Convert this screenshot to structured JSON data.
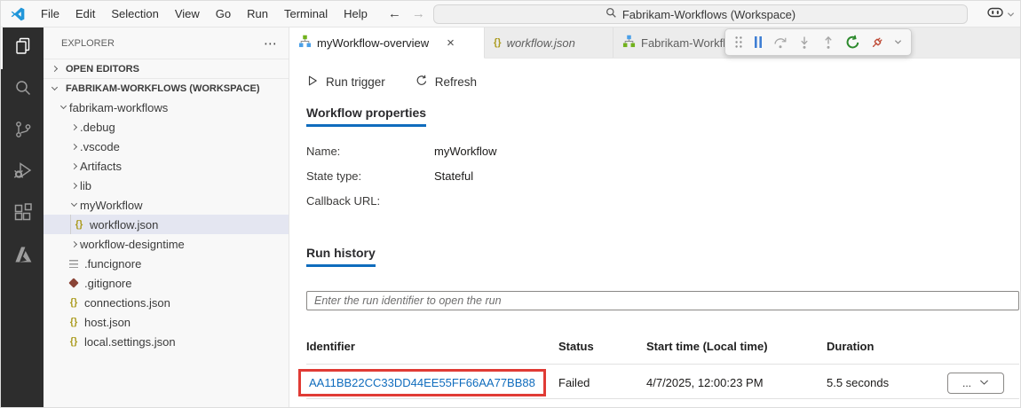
{
  "titlebar": {
    "menus": [
      "File",
      "Edit",
      "Selection",
      "View",
      "Go",
      "Run",
      "Terminal",
      "Help"
    ],
    "back_arrow": "←",
    "forward_arrow": "→",
    "search_label": "Fabrikam-Workflows (Workspace)"
  },
  "activity_bar": {
    "items": [
      "explorer",
      "search",
      "source-control",
      "run-and-debug",
      "extensions",
      "azure"
    ],
    "active_item": "explorer"
  },
  "sidebar": {
    "title": "EXPLORER",
    "sections": [
      {
        "label": "OPEN EDITORS",
        "expanded": false
      },
      {
        "label": "FABRIKAM-WORKFLOWS (WORKSPACE)",
        "expanded": true
      }
    ],
    "tree": [
      {
        "label": "fabrikam-workflows",
        "icon": "chevron-down-icon"
      },
      {
        "label": ".debug",
        "icon": "chevron-right-icon"
      },
      {
        "label": ".vscode",
        "icon": "chevron-right-icon"
      },
      {
        "label": "Artifacts",
        "icon": "chevron-right-icon"
      },
      {
        "label": "lib",
        "icon": "chevron-right-icon"
      },
      {
        "label": "myWorkflow",
        "icon": "chevron-down-icon"
      },
      {
        "label": "workflow.json",
        "icon": "braces-icon",
        "selected": true
      },
      {
        "label": "workflow-designtime",
        "icon": "chevron-right-icon"
      },
      {
        "label": ".funcignore",
        "icon": "list-icon"
      },
      {
        "label": ".gitignore",
        "icon": "git-diamond-icon"
      },
      {
        "label": "connections.json",
        "icon": "braces-icon"
      },
      {
        "label": "host.json",
        "icon": "braces-icon"
      },
      {
        "label": "local.settings.json",
        "icon": "braces-icon"
      }
    ]
  },
  "editor": {
    "tabs": [
      {
        "label": "myWorkflow-overview",
        "icon": "workflow-icon",
        "active": true
      },
      {
        "label": "workflow.json",
        "icon": "braces-icon",
        "preview": true
      },
      {
        "label": "Fabrikam-Workflows-Stateful-Workflow",
        "icon": "workflow-icon"
      }
    ],
    "debug_toolbar": [
      "drag-grip",
      "pause",
      "step-over",
      "step-into",
      "step-out",
      "restart",
      "disconnect"
    ],
    "commands": {
      "run_trigger": "Run trigger",
      "refresh": "Refresh"
    },
    "workflow_properties": {
      "title": "Workflow properties",
      "rows": [
        {
          "label": "Name:",
          "value": "myWorkflow"
        },
        {
          "label": "State type:",
          "value": "Stateful"
        },
        {
          "label": "Callback URL:",
          "value": ""
        }
      ]
    },
    "run_history": {
      "title": "Run history",
      "input_placeholder": "Enter the run identifier to open the run",
      "table": {
        "headers": [
          "Identifier",
          "Status",
          "Start time (Local time)",
          "Duration"
        ],
        "rows": [
          {
            "identifier": "AA11BB22CC33DD44EE55FF66AA77BB88",
            "status": "Failed",
            "start_time": "4/7/2025, 12:00:23 PM",
            "duration": "5.5 seconds",
            "actions": "..."
          }
        ]
      }
    }
  },
  "colors": {
    "accent": "#0f6cbd",
    "link": "#0f6cbd",
    "highlight_red": "#e03b35",
    "selected_item_bg": "#e4e6f1",
    "activity_bar_bg": "#2d2d2d"
  }
}
